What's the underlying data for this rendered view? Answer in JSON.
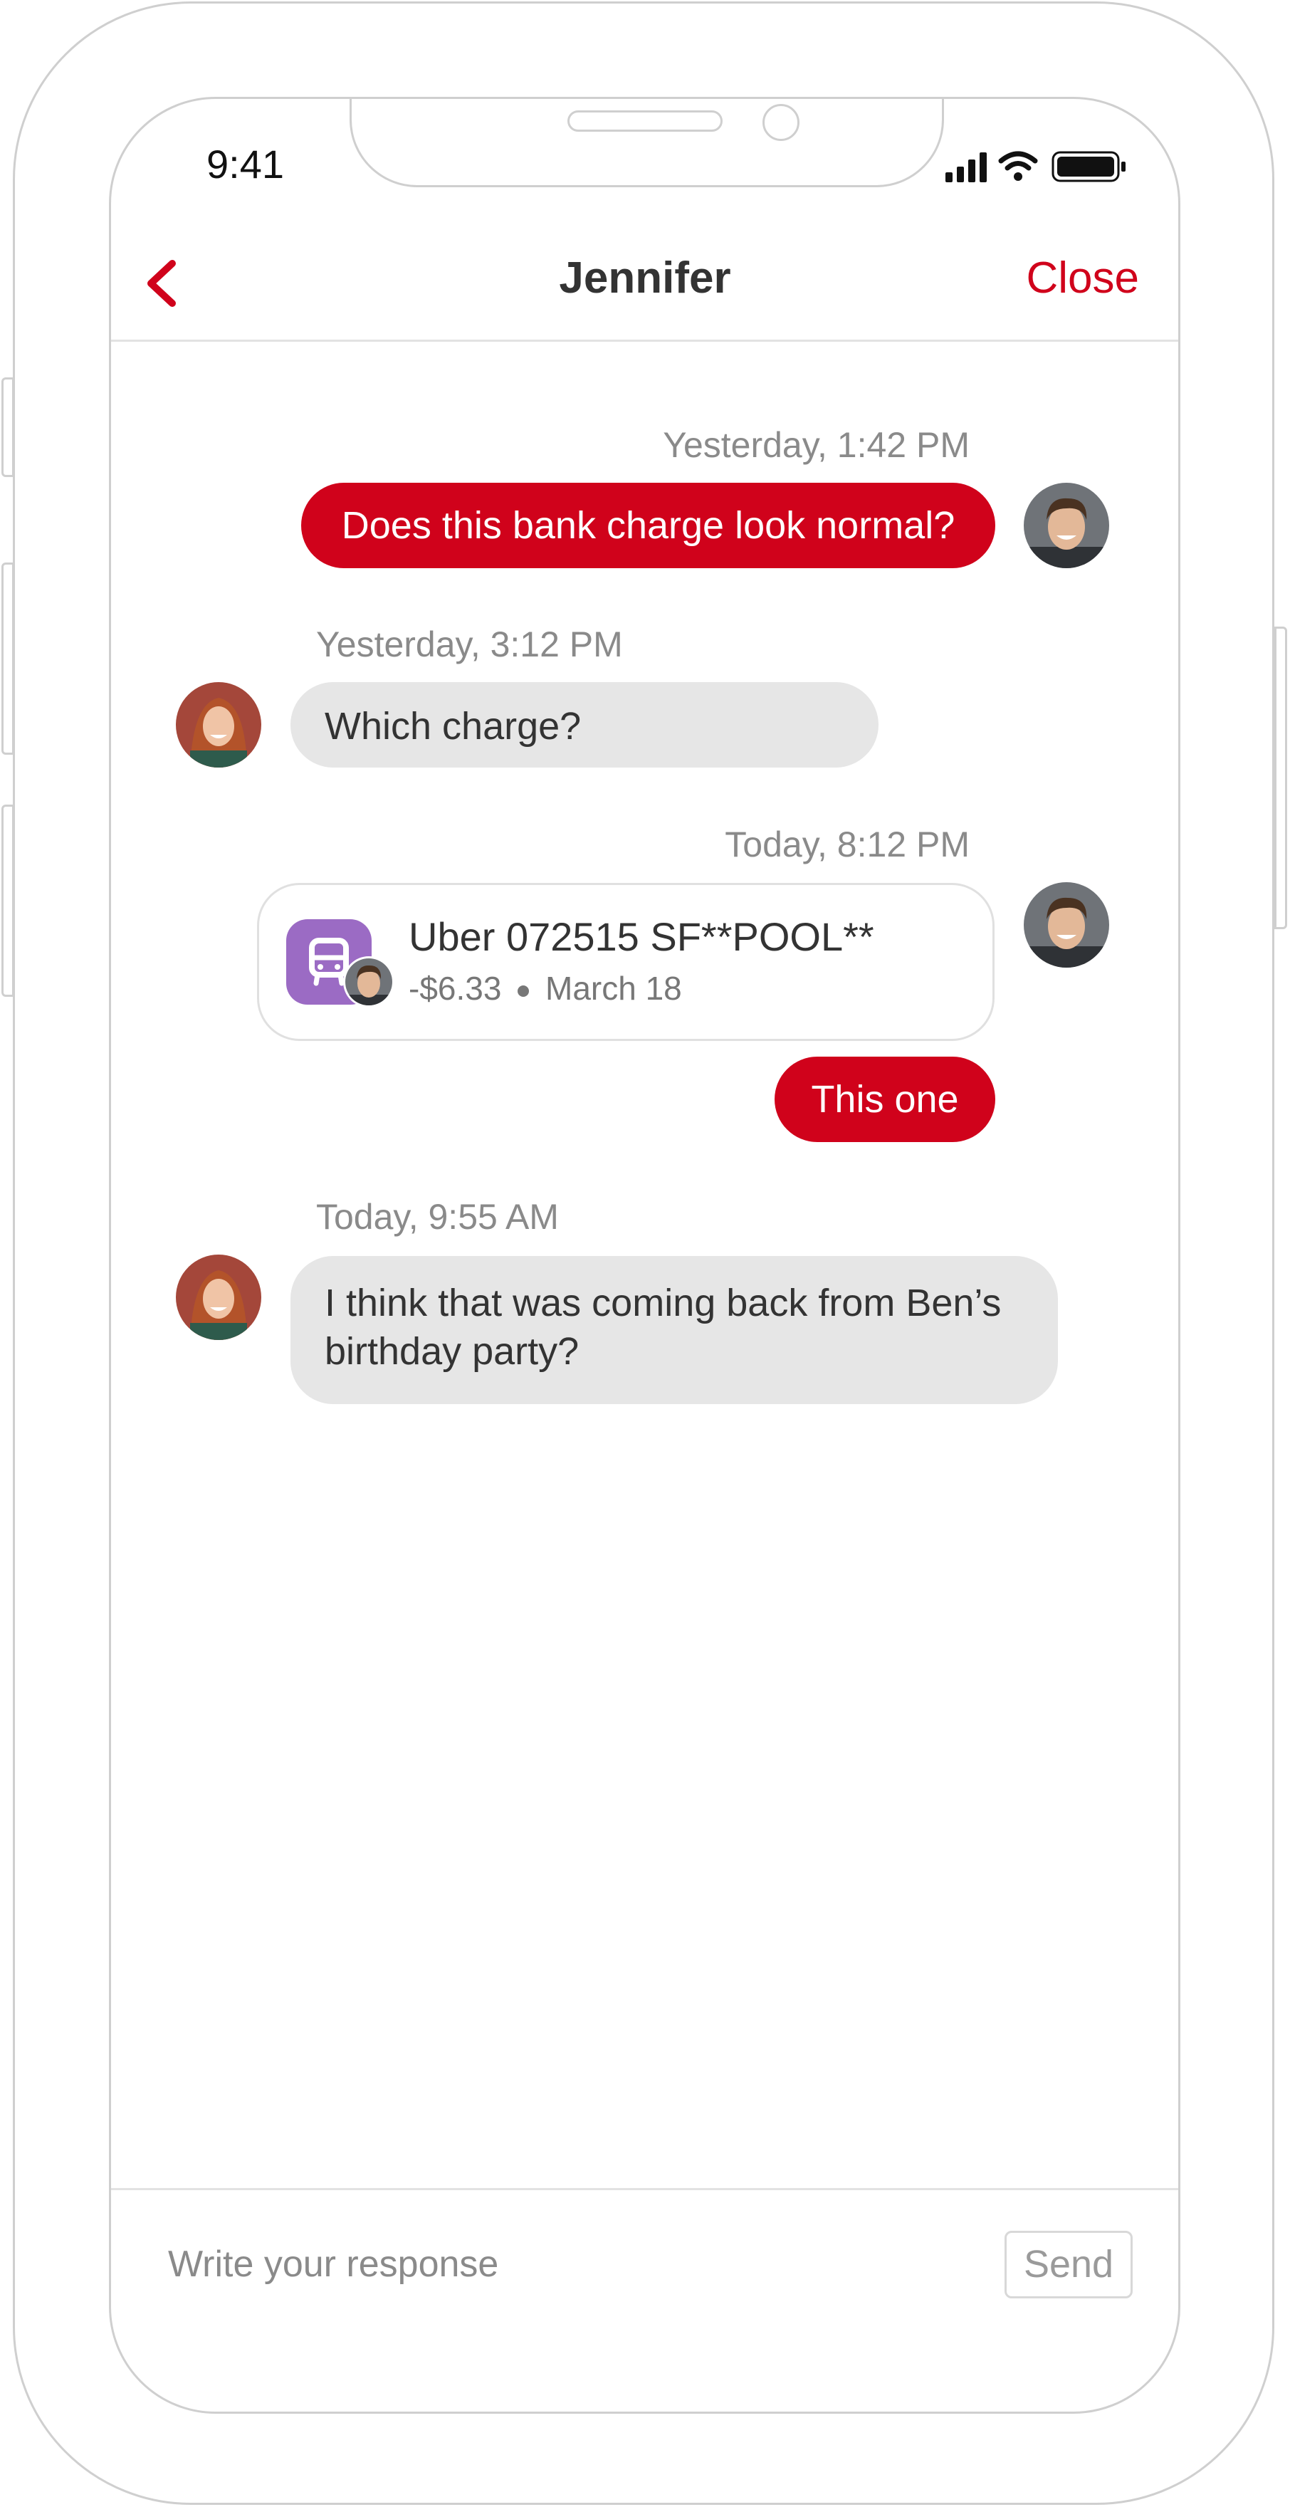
{
  "status_bar": {
    "time": "9:41",
    "icons": [
      "signal-icon",
      "wifi-icon",
      "battery-icon"
    ]
  },
  "nav": {
    "back_icon": "chevron-left-icon",
    "title": "Jennifer",
    "close_label": "Close"
  },
  "colors": {
    "accent": "#d0021b",
    "incoming_bubble": "#e6e6e6",
    "transaction_icon_bg": "#9b6bc4"
  },
  "messages": [
    {
      "direction": "outgoing",
      "timestamp": "Yesterday, 1:42 PM",
      "text": "Does this bank charge look normal?"
    },
    {
      "direction": "incoming",
      "timestamp": "Yesterday, 3:12 PM",
      "text": "Which charge?"
    },
    {
      "direction": "outgoing",
      "timestamp": "Today, 8:12 PM",
      "transaction": {
        "icon": "bus-icon",
        "merchant": "Uber 072515 SF**POOL**",
        "amount": "-$6.33",
        "date": "March 18"
      },
      "text": "This one"
    },
    {
      "direction": "incoming",
      "timestamp": "Today, 9:55 AM",
      "text_line1": "I think that was coming back from Ben’s",
      "text_line2": "birthday party?"
    }
  ],
  "composer": {
    "placeholder": "Write your response",
    "send_label": "Send"
  }
}
